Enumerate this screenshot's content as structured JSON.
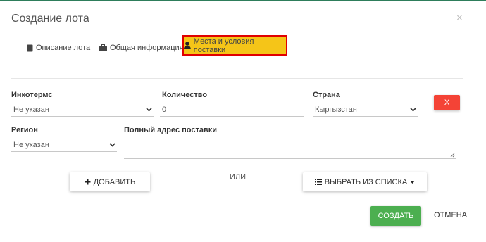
{
  "dialog": {
    "title": "Создание лота",
    "close_label": "×"
  },
  "tabs": [
    {
      "label": "Описание лота",
      "icon": "book-icon"
    },
    {
      "label": "Общая информация",
      "icon": "briefcase-icon"
    },
    {
      "label": "Места и условия поставки",
      "icon": "user-icon",
      "active": true
    }
  ],
  "form": {
    "incoterms": {
      "label": "Инкотермс",
      "value": "Не указан"
    },
    "quantity": {
      "label": "Количество",
      "value": "0"
    },
    "country": {
      "label": "Страна",
      "value": "Кыргызстан"
    },
    "region": {
      "label": "Регион",
      "value": "Не указан"
    },
    "address": {
      "label": "Полный адрес поставки",
      "value": ""
    },
    "remove_label": "X"
  },
  "actions": {
    "add_label": "ДОБАВИТЬ",
    "or_label": "ИЛИ",
    "select_label": "ВЫБРАТЬ ИЗ СПИСКА"
  },
  "footer": {
    "create_label": "СОЗДАТЬ",
    "cancel_label": "ОТМЕНА"
  },
  "colors": {
    "accent_green": "#4caf50",
    "danger": "#f44336",
    "tab_highlight": "#f5c518",
    "tab_border": "#e00000"
  }
}
